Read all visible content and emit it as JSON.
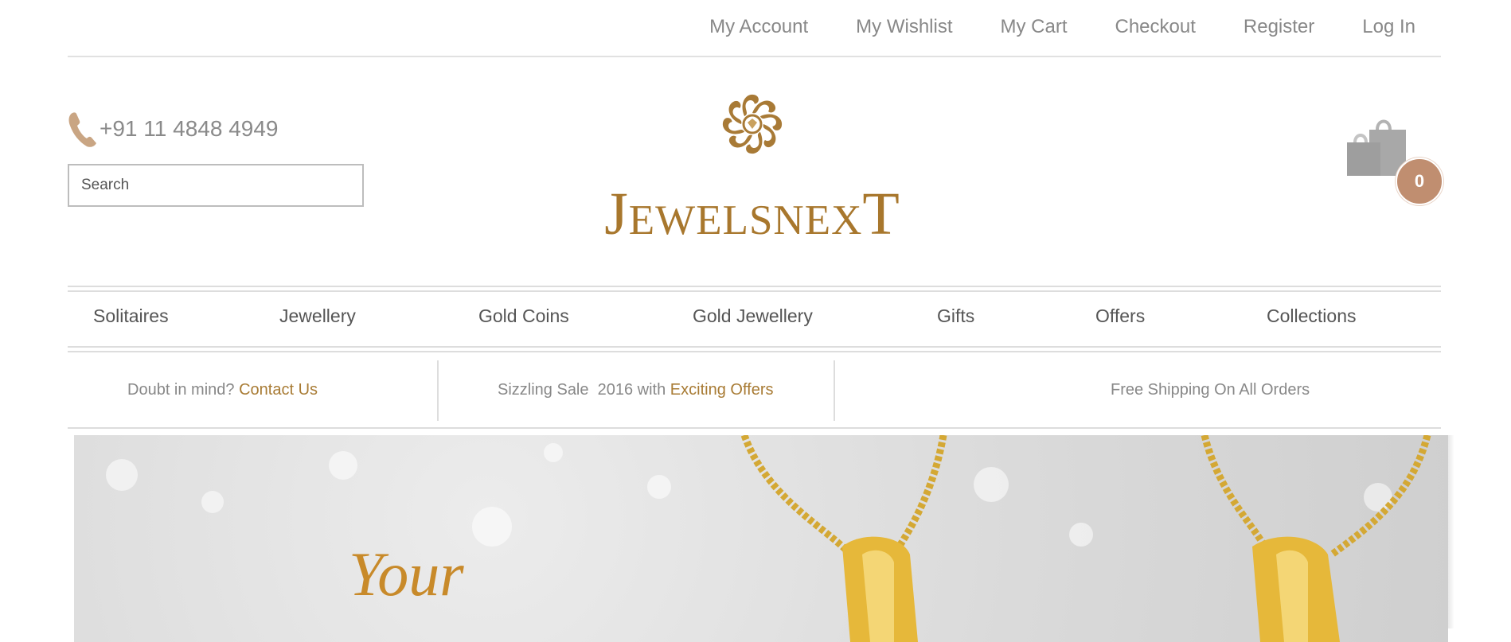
{
  "top_links": [
    "My Account",
    "My Wishlist",
    "My Cart",
    "Checkout",
    "Register",
    "Log In"
  ],
  "header": {
    "phone": "+91 11 4848 4949",
    "search_placeholder": "Search",
    "logo_text": "JewelsnexT",
    "cart_count": "0"
  },
  "nav": [
    "Solitaires",
    "Jewellery",
    "Gold Coins",
    "Gold Jewellery",
    "Gifts",
    "Offers",
    "Collections"
  ],
  "info": {
    "doubt_text": "Doubt in mind?",
    "doubt_link": "Contact Us",
    "sale_text": "Sizzling Sale  2016 with",
    "sale_link": "Exciting Offers",
    "shipping": "Free Shipping On All Orders"
  },
  "banner": {
    "text": "Your"
  },
  "colors": {
    "brand_gold": "#a8772d",
    "accent": "#a87b34",
    "cart_badge": "#c08e70"
  },
  "icons": [
    "phone-icon",
    "shopping-bags-icon",
    "logo-emblem-icon"
  ]
}
